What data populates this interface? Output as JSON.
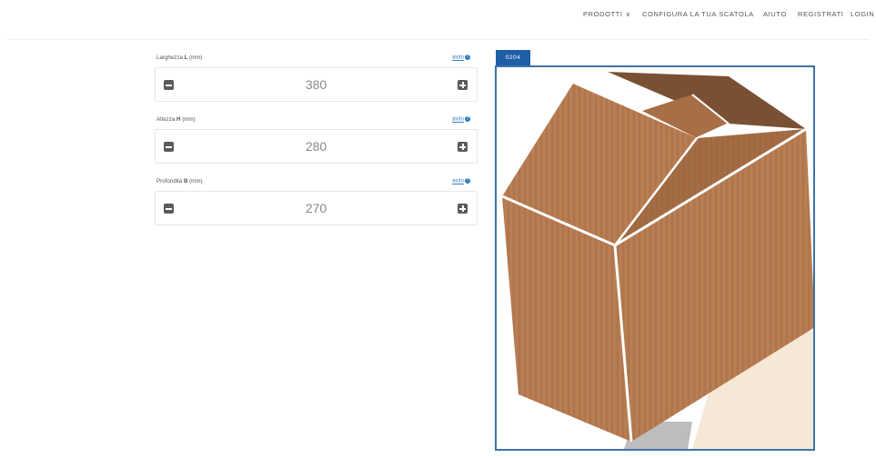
{
  "nav": {
    "prodotti": "PRODOTTI",
    "configura": "CONFIGURA LA TUA SCATOLA",
    "aiuto": "AIUTO",
    "registrati": "REGISTRATI",
    "login": "LOGIN"
  },
  "form": {
    "width": {
      "label_pre": "Larghezza ",
      "label_key": "L",
      "label_post": " (mm)",
      "help": "aiuto",
      "value": "380"
    },
    "height": {
      "label_pre": "Altezza ",
      "label_key": "H",
      "label_post": " (mm)",
      "help": "aiuto",
      "value": "280"
    },
    "depth": {
      "label_pre": "Profondità ",
      "label_key": "B",
      "label_post": " (mm)",
      "help": "aiuto",
      "value": "270"
    }
  },
  "preview": {
    "tab_label": "0204"
  },
  "colors": {
    "accent": "#1f5fa6",
    "frame_border": "#3d73a8",
    "cardboard": "#b87c52"
  }
}
